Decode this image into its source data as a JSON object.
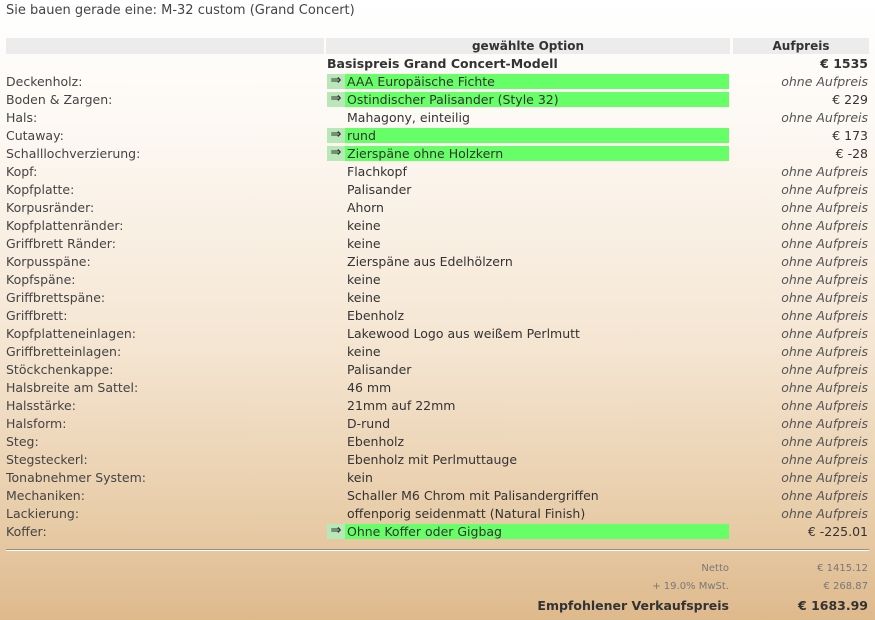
{
  "title": "Sie bauen gerade eine: M-32 custom (Grand Concert)",
  "header": {
    "option": "gewählte Option",
    "surcharge": "Aufpreis"
  },
  "base": {
    "label": "Basispreis Grand Concert-Modell",
    "price": "€ 1535"
  },
  "rows": [
    {
      "label": "Deckenholz:",
      "option": "AAA Europäische Fichte",
      "price": "ohne Aufpreis",
      "hl": true
    },
    {
      "label": "Boden & Zargen:",
      "option": "Ostindischer Palisander (Style 32)",
      "price": "€ 229",
      "hl": true
    },
    {
      "label": "Hals:",
      "option": "Mahagony, einteilig",
      "price": "ohne Aufpreis",
      "hl": false
    },
    {
      "label": "Cutaway:",
      "option": "rund",
      "price": "€ 173",
      "hl": true
    },
    {
      "label": "Schalllochverzierung:",
      "option": "Zierspäne ohne Holzkern",
      "price": "€ -28",
      "hl": true
    },
    {
      "label": "Kopf:",
      "option": "Flachkopf",
      "price": "ohne Aufpreis",
      "hl": false
    },
    {
      "label": "Kopfplatte:",
      "option": "Palisander",
      "price": "ohne Aufpreis",
      "hl": false
    },
    {
      "label": "Korpusränder:",
      "option": "Ahorn",
      "price": "ohne Aufpreis",
      "hl": false
    },
    {
      "label": "Kopfplattenränder:",
      "option": "keine",
      "price": "ohne Aufpreis",
      "hl": false
    },
    {
      "label": "Griffbrett Ränder:",
      "option": "keine",
      "price": "ohne Aufpreis",
      "hl": false
    },
    {
      "label": "Korpusspäne:",
      "option": "Zierspäne aus Edelhölzern",
      "price": "ohne Aufpreis",
      "hl": false
    },
    {
      "label": "Kopfspäne:",
      "option": "keine",
      "price": "ohne Aufpreis",
      "hl": false
    },
    {
      "label": "Griffbrettspäne:",
      "option": "keine",
      "price": "ohne Aufpreis",
      "hl": false
    },
    {
      "label": "Griffbrett:",
      "option": "Ebenholz",
      "price": "ohne Aufpreis",
      "hl": false
    },
    {
      "label": "Kopfplatteneinlagen:",
      "option": "Lakewood Logo aus weißem Perlmutt",
      "price": "ohne Aufpreis",
      "hl": false
    },
    {
      "label": "Griffbretteinlagen:",
      "option": "keine",
      "price": "ohne Aufpreis",
      "hl": false
    },
    {
      "label": "Stöckchenkappe:",
      "option": "Palisander",
      "price": "ohne Aufpreis",
      "hl": false
    },
    {
      "label": "Halsbreite am Sattel:",
      "option": "46 mm",
      "price": "ohne Aufpreis",
      "hl": false
    },
    {
      "label": "Halsstärke:",
      "option": "21mm auf 22mm",
      "price": "ohne Aufpreis",
      "hl": false
    },
    {
      "label": "Halsform:",
      "option": "D-rund",
      "price": "ohne Aufpreis",
      "hl": false
    },
    {
      "label": "Steg:",
      "option": "Ebenholz",
      "price": "ohne Aufpreis",
      "hl": false
    },
    {
      "label": "Stegsteckerl:",
      "option": "Ebenholz mit Perlmuttauge",
      "price": "ohne Aufpreis",
      "hl": false
    },
    {
      "label": "Tonabnehmer System:",
      "option": "kein",
      "price": "ohne Aufpreis",
      "hl": false
    },
    {
      "label": "Mechaniken:",
      "option": "Schaller M6 Chrom mit Palisandergriffen",
      "price": "ohne Aufpreis",
      "hl": false
    },
    {
      "label": "Lackierung:",
      "option": "offenporig seidenmatt (Natural Finish)",
      "price": "ohne Aufpreis",
      "hl": false
    },
    {
      "label": "Koffer:",
      "option": "Ohne Koffer oder Gigbag",
      "price": "€ -225.01",
      "hl": true
    }
  ],
  "arrow_glyph": "⇒",
  "totals": {
    "netto_label": "Netto",
    "netto_value": "€ 1415.12",
    "vat_label": "+ 19.0% MwSt.",
    "vat_value": "€ 268.87",
    "final_label": "Empfohlener Verkaufspreis",
    "final_value": "€ 1683.99"
  },
  "colors": {
    "highlight": "#67ff67",
    "arrow_bg": "#b8e8b8",
    "header_bg": "#ececec"
  }
}
